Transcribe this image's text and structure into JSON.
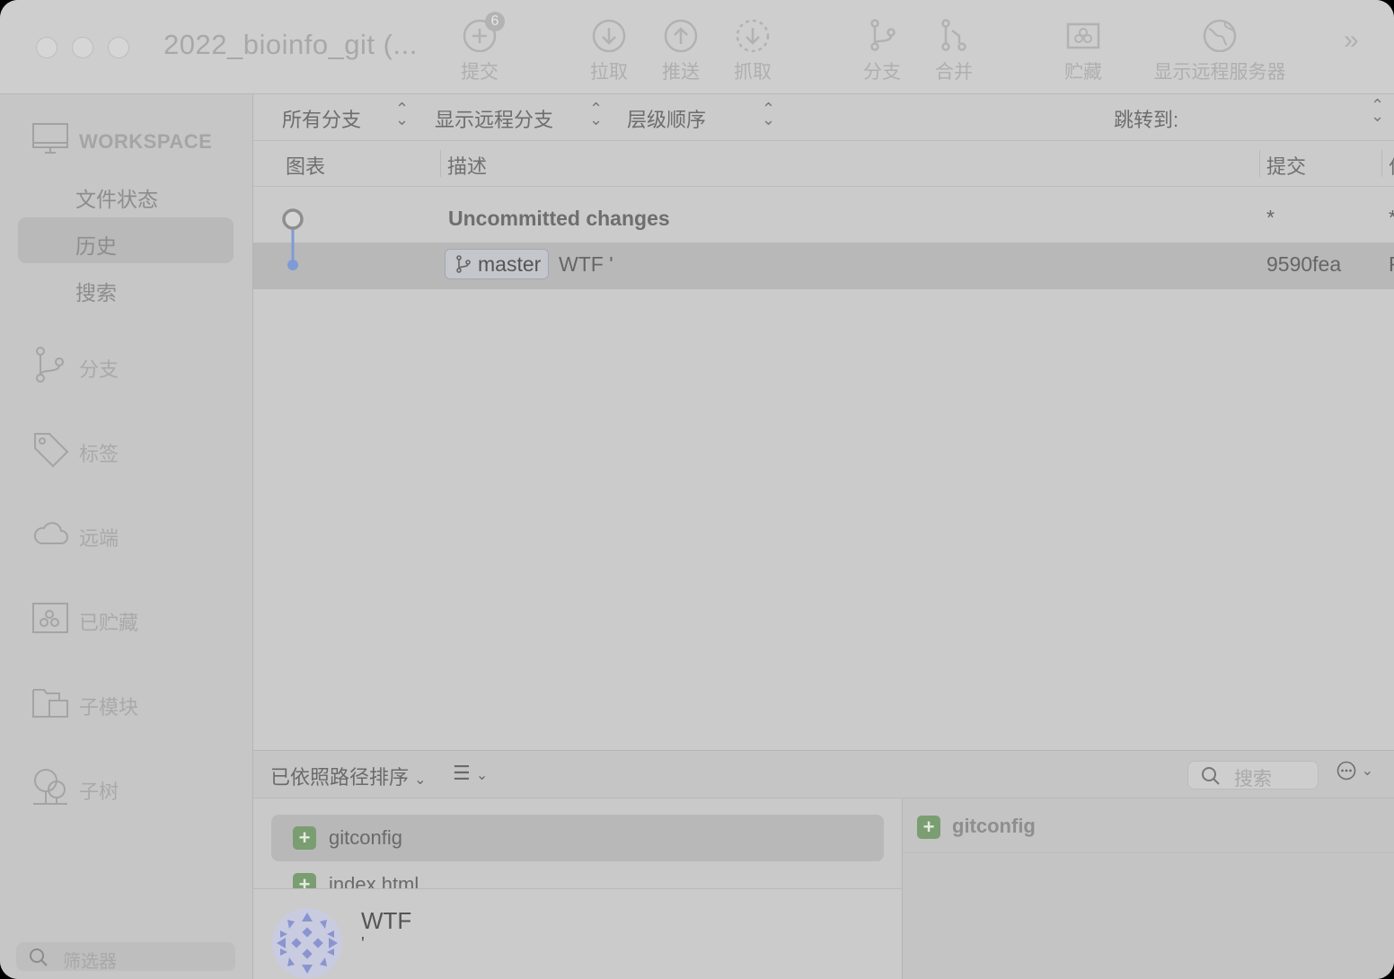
{
  "window": {
    "title": "2022_bioinfo_git (..."
  },
  "toolbar": {
    "commit_badge": "6",
    "buttons": [
      "提交",
      "拉取",
      "推送",
      "抓取",
      "分支",
      "合并",
      "贮藏",
      "显示远程服务器"
    ]
  },
  "sidebar": {
    "workspace_label": "WORKSPACE",
    "workspace_items": [
      "文件状态",
      "历史",
      "搜索"
    ],
    "sections": [
      "分支",
      "标签",
      "远端",
      "已贮藏",
      "子模块",
      "子树"
    ],
    "filter_placeholder": "筛选器"
  },
  "filterbar": {
    "branches": "所有分支",
    "remote": "显示远程分支",
    "order": "层级顺序",
    "jump_to": "跳转到:"
  },
  "columns": {
    "graph": "图表",
    "description": "描述",
    "commit": "提交",
    "author_partial": "作"
  },
  "rows": [
    {
      "description": "Uncommitted changes",
      "commit": "*",
      "trailing": "*"
    },
    {
      "branch": "master",
      "message": "WTF '",
      "commit": "9590fea",
      "trailing": "F"
    }
  ],
  "bottom": {
    "sort_label": "已依照路径排序",
    "search_placeholder": "搜索",
    "files": [
      "gitconfig",
      "index.html"
    ],
    "commit_message": "WTF",
    "commit_sub": "'",
    "diff_file": "gitconfig"
  },
  "colors": {
    "window_bg": "#cbcbcb",
    "selected_row": "#b8b8b8",
    "added_icon": "#7a9e72",
    "graph_line": "#7f9bd6"
  }
}
